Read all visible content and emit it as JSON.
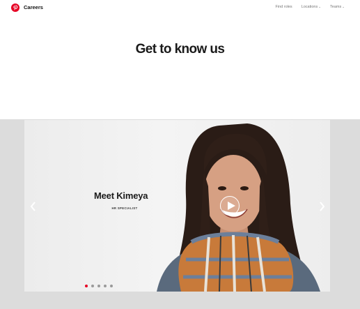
{
  "header": {
    "brand": "Careers",
    "logo_icon": "pinterest-logo-icon",
    "nav": [
      {
        "label": "Find roles",
        "has_chevron": false
      },
      {
        "label": "Locations",
        "has_chevron": true
      },
      {
        "label": "Teams",
        "has_chevron": true
      }
    ]
  },
  "hero": {
    "title": "Get to know us"
  },
  "gallery": {
    "slide_title": "Meet Kimeya",
    "slide_subtitle": "HR SPECIALIST",
    "active_slide": 1,
    "slide_count": 5,
    "icons": {
      "prev": "chevron-left-icon",
      "next": "chevron-right-icon",
      "play": "play-icon"
    }
  },
  "colors": {
    "brand_red": "#e60023",
    "title": "#1a1a1a",
    "nav_text": "#767676",
    "band_bg": "#dcdcdc"
  }
}
